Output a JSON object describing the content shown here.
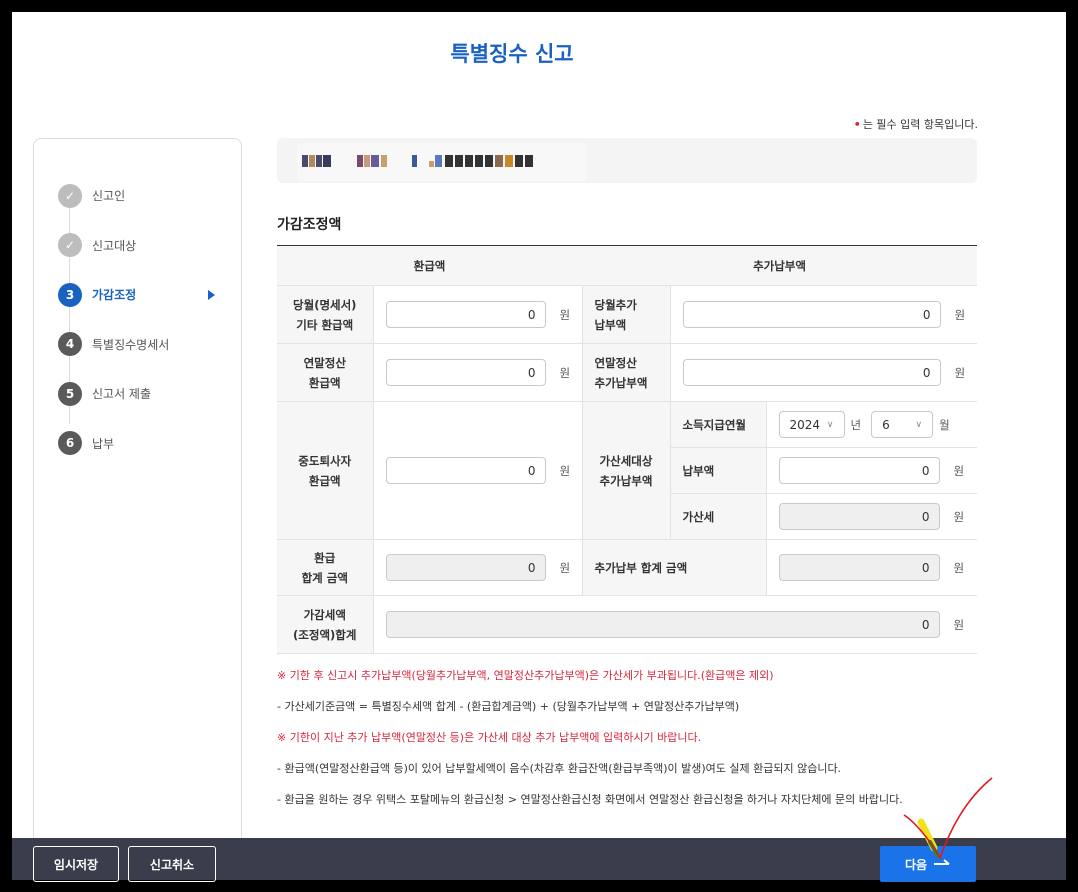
{
  "page_title": "특별징수 신고",
  "required_note": "는 필수 입력 항목입니다.",
  "sidebar": {
    "steps": [
      {
        "num": "✓",
        "label": "신고인",
        "state": "done"
      },
      {
        "num": "✓",
        "label": "신고대상",
        "state": "done"
      },
      {
        "num": "3",
        "label": "가감조정",
        "state": "active"
      },
      {
        "num": "4",
        "label": "특별징수명세서",
        "state": "todo"
      },
      {
        "num": "5",
        "label": "신고서 제출",
        "state": "todo"
      },
      {
        "num": "6",
        "label": "납부",
        "state": "todo"
      }
    ]
  },
  "section_title": "가감조정액",
  "table": {
    "head_refund": "환급액",
    "head_additional": "추가납부액",
    "unit": "원",
    "rows": {
      "monthly_refund_label": "당월(명세서)\n기타 환급액",
      "monthly_refund_value": "0",
      "monthly_additional_label": "당월추가\n납부액",
      "monthly_additional_value": "0",
      "yearend_refund_label": "연말정산\n환급액",
      "yearend_refund_value": "0",
      "yearend_additional_label": "연말정산\n추가납부액",
      "yearend_additional_value": "0",
      "retiree_refund_label": "중도퇴사자\n환급액",
      "retiree_refund_value": "0",
      "penalty_target_label": "가산세대상\n추가납부액",
      "income_month_label": "소득지급연월",
      "year_value": "2024",
      "year_unit": "년",
      "month_value": "6",
      "month_unit": "월",
      "payment_label": "납부액",
      "payment_value": "0",
      "penalty_label": "가산세",
      "penalty_value": "0",
      "refund_total_label": "환급\n합계 금액",
      "refund_total_value": "0",
      "additional_total_label": "추가납부 합계 금액",
      "additional_total_value": "0",
      "adjust_total_label": "가감세액\n(조정액)합계",
      "adjust_total_value": "0"
    }
  },
  "notes": [
    {
      "text": "※ 기한 후 신고시 추가납부액(당월추가납부액, 연말정산추가납부액)은 가산세가 부과됩니다.(환급액은 제외)",
      "warn": true
    },
    {
      "text": "- 가산세기준금액 = 특별징수세액 합계 - (환급합계금액) + (당월추가납부액 + 연말정산추가납부액)",
      "warn": false
    },
    {
      "text": "※ 기한이 지난 추가 납부액(연말정산 등)은 가산세 대상 추가 납부액에 입력하시기 바랍니다.",
      "warn": true
    },
    {
      "text": "- 환급액(연말정산환급액 등)이 있어 납부할세액이 음수(차감후 환급잔액(환급부족액)이 발생)여도 실제 환급되지 않습니다.",
      "warn": false
    },
    {
      "text": "- 환급을 원하는 경우 위택스 포탈메뉴의 환급신청 > 연말정산환급신청 화면에서 연말정산 환급신청을 하거나 자치단체에 문의 바랍니다.",
      "warn": false
    }
  ],
  "bottom": {
    "temp_save": "임시저장",
    "cancel": "신고취소",
    "next": "다음"
  },
  "colors": {
    "accent": "#1a62c2",
    "warn": "#d7263d",
    "bar": "#3a3e4c"
  }
}
